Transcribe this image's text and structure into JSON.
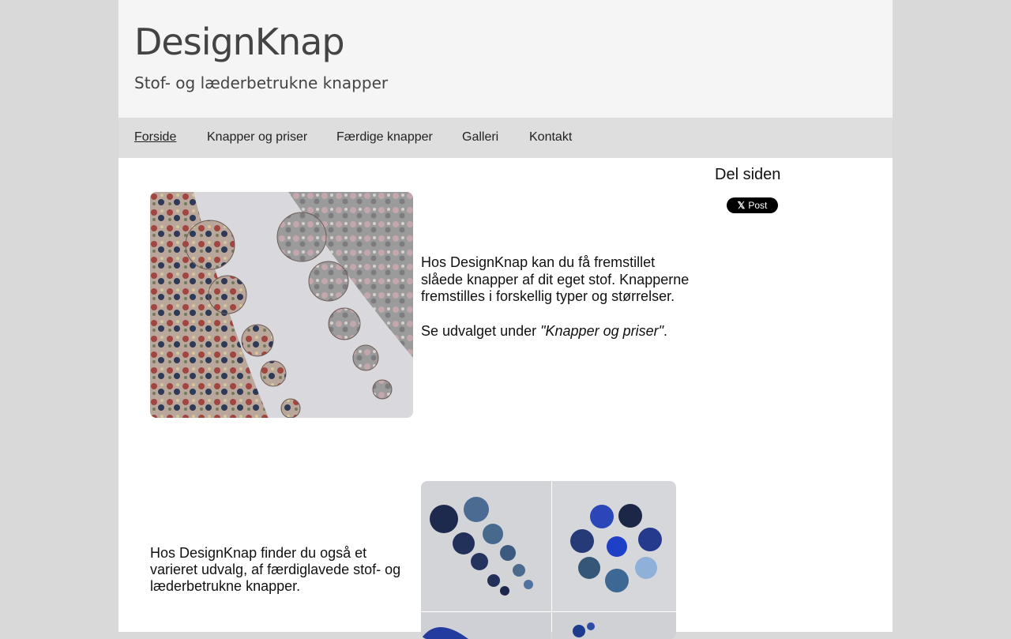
{
  "header": {
    "title": "DesignKnap",
    "tagline": "Stof- og læderbetrukne knapper"
  },
  "nav": {
    "items": [
      {
        "label": "Forside",
        "active": true
      },
      {
        "label": "Knapper og priser",
        "active": false
      },
      {
        "label": "Færdige knapper",
        "active": false
      },
      {
        "label": "Galleri",
        "active": false
      },
      {
        "label": "Kontakt",
        "active": false
      }
    ]
  },
  "main": {
    "intro_p1": "Hos DesignKnap kan du få fremstillet slåede knapper af dit eget stof. Knapperne fremstilles i forskellig typer og størrelser.",
    "intro_p2_prefix": "Se udvalget under ",
    "intro_p2_link": "\"Knapper og priser\"",
    "intro_p2_suffix": ".",
    "second_text": "Hos DesignKnap finder du også et varieret udvalg, af færdiglavede stof- og læderbetrukne knapper.",
    "image1_icon": "paisley-buttons-photo",
    "image2_icon": "blue-buttons-photo"
  },
  "sidebar": {
    "share_title": "Del siden",
    "x_post_label": "Post",
    "x_icon": "x-logo-icon"
  },
  "colors": {
    "page_bg": "#d9d9d9",
    "header_bg": "#f5f5f5",
    "nav_bg": "#dedede",
    "x_button_bg": "#000000"
  }
}
